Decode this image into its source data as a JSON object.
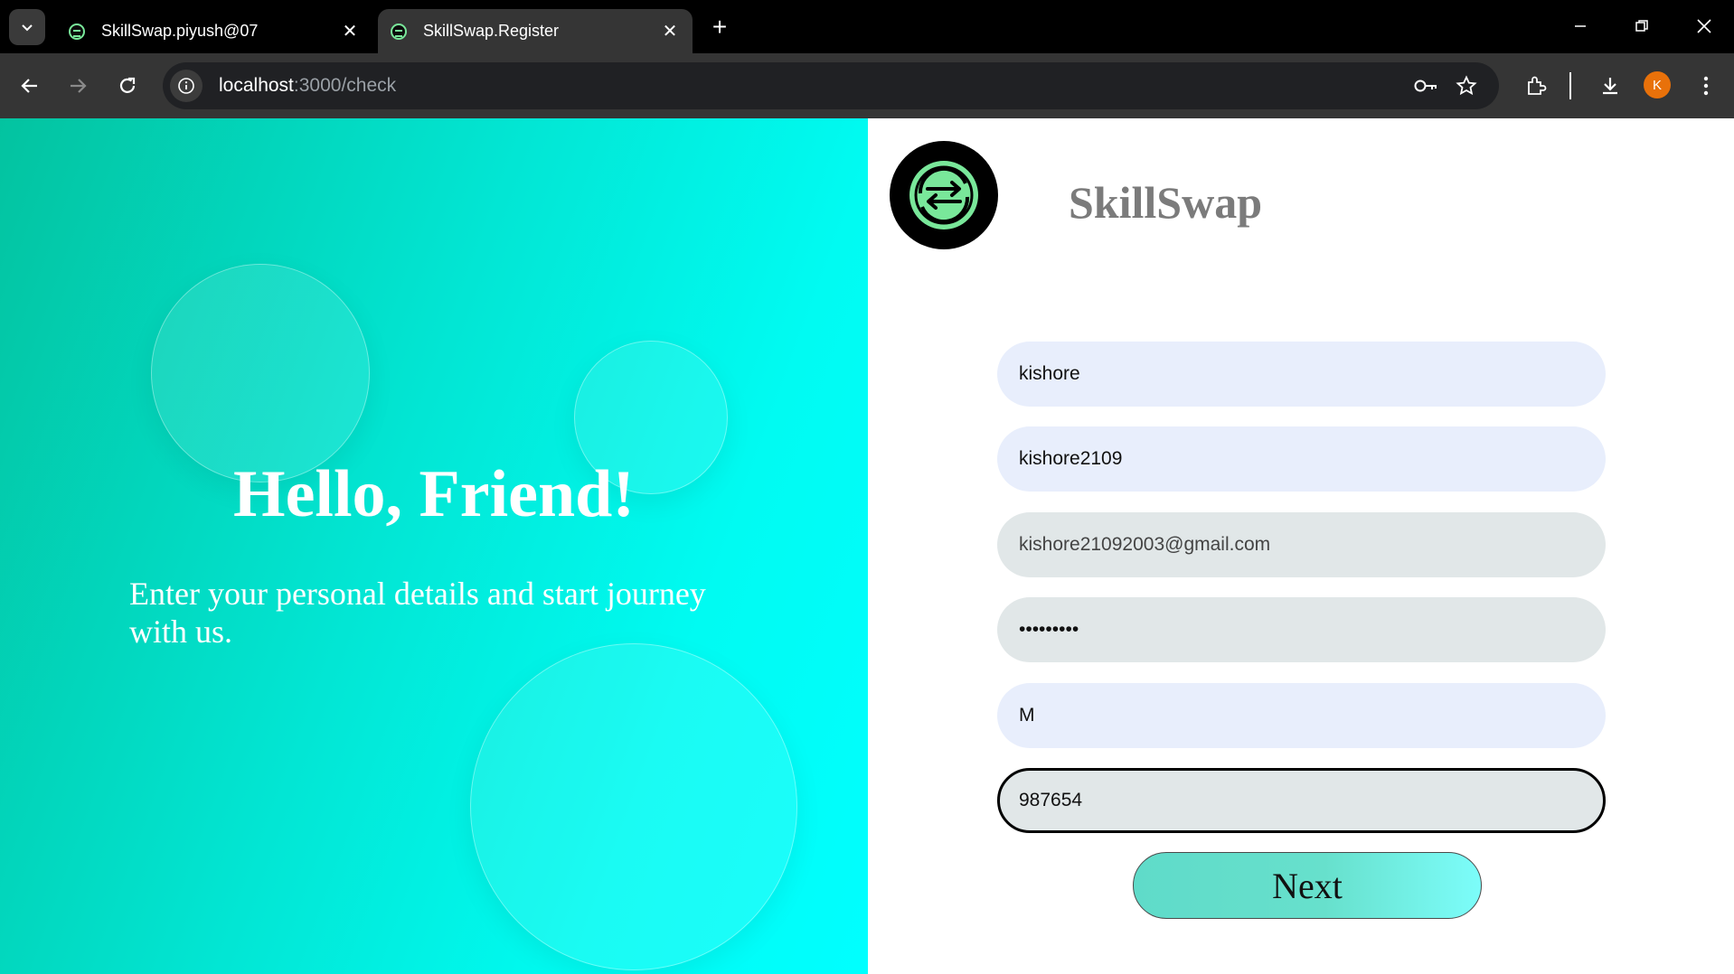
{
  "browser": {
    "tabs": [
      {
        "title": "SkillSwap.piyush@07",
        "active": false
      },
      {
        "title": "SkillSwap.Register",
        "active": true
      }
    ],
    "address": {
      "host": "localhost",
      "path": ":3000/check"
    },
    "profile_initial": "K",
    "icons": [
      "tab-search-icon",
      "close-icon",
      "new-tab-icon",
      "minimize-icon",
      "restore-icon",
      "close-window-icon",
      "back-arrow-icon",
      "forward-arrow-icon",
      "reload-icon",
      "site-info-icon",
      "password-key-icon",
      "bookmark-star-icon",
      "extensions-icon",
      "download-icon",
      "menu-dots-icon"
    ]
  },
  "welcome": {
    "heading": "Hello, Friend!",
    "message": "Enter your personal details and start journey with us."
  },
  "brand": {
    "name": "SkillSwap",
    "logo_icon": "swap-arrows-icon"
  },
  "form": {
    "name": "kishore",
    "username": "kishore2109",
    "email": "kishore21092003@gmail.com",
    "password": "kishore21",
    "gender": "M",
    "phone": "987654",
    "submit_label": "Next"
  },
  "colors": {
    "gradient_start": "#03c3a0",
    "gradient_end": "#00ffff",
    "brand_text": "#7b7b7b",
    "input_bg": "#e8eefc",
    "input_bg_alt": "#e1e7e8",
    "logo_green": "#79e79a"
  }
}
